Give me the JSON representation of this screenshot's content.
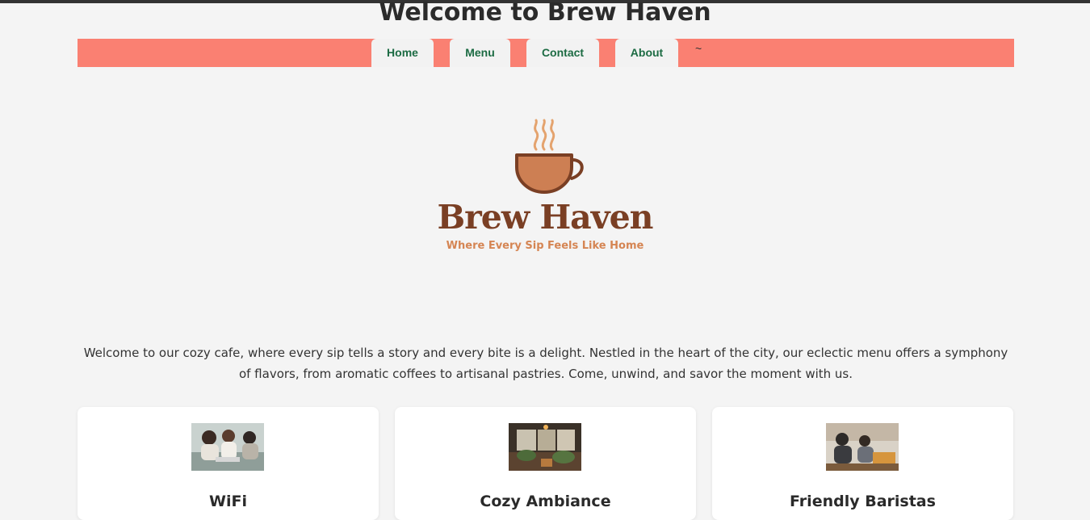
{
  "header": {
    "title": "Welcome to Brew Haven"
  },
  "nav": {
    "items": [
      {
        "label": "Home"
      },
      {
        "label": "Menu"
      },
      {
        "label": "Contact"
      },
      {
        "label": "About"
      }
    ],
    "extra": "~"
  },
  "logo": {
    "name": "Brew Haven",
    "tagline": "Where Every Sip Feels Like Home"
  },
  "intro": {
    "text": "Welcome to our cozy cafe, where every sip tells a story and every bite is a delight. Nestled in the heart of the city, our eclectic menu offers a symphony of flavors, from aromatic coffees to artisanal pastries. Come, unwind, and savor the moment with us."
  },
  "features": [
    {
      "title": "WiFi"
    },
    {
      "title": "Cozy Ambiance"
    },
    {
      "title": "Friendly Baristas"
    }
  ],
  "colors": {
    "nav_background": "#fa8072",
    "nav_text": "#1c6b43",
    "logo_brown": "#7a3f24",
    "logo_orange": "#d58553",
    "page_background": "#f4f4f4"
  }
}
